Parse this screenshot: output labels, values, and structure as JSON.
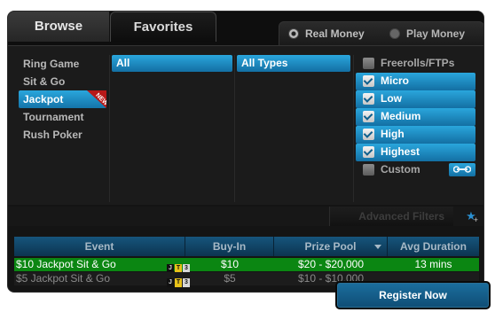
{
  "tabs": {
    "browse": "Browse",
    "favorites": "Favorites"
  },
  "money_mode": {
    "real": "Real Money",
    "play": "Play Money",
    "selected": "real"
  },
  "game_types": [
    {
      "label": "Ring Game"
    },
    {
      "label": "Sit & Go"
    },
    {
      "label": "Jackpot",
      "badge": "NEW"
    },
    {
      "label": "Tournament"
    },
    {
      "label": "Rush Poker"
    }
  ],
  "filters": {
    "game_filter": "All",
    "type_filter": "All Types"
  },
  "stakes": {
    "freerolls": "Freerolls/FTPs",
    "levels": [
      "Micro",
      "Low",
      "Medium",
      "High",
      "Highest"
    ],
    "custom": "Custom"
  },
  "advanced_filters": "Advanced Filters",
  "table": {
    "headers": {
      "event": "Event",
      "buyin": "Buy-In",
      "prize": "Prize Pool",
      "duration": "Avg Duration"
    },
    "rows": [
      {
        "event": "$10 Jackpot Sit & Go",
        "icons": [
          "J",
          "T",
          "3"
        ],
        "buyin": "$10",
        "prize": "$20 - $20,000",
        "duration": "13 mins"
      },
      {
        "event": "$5 Jackpot Sit & Go",
        "icons": [
          "J",
          "T",
          "3"
        ],
        "buyin": "$5",
        "prize": "$10 - $10,000",
        "duration": ""
      }
    ]
  },
  "register_button": "Register Now",
  "colors": {
    "accent_blue": "#2aa6dc",
    "selected_row": "#0b8612",
    "new_badge": "#b81818"
  }
}
